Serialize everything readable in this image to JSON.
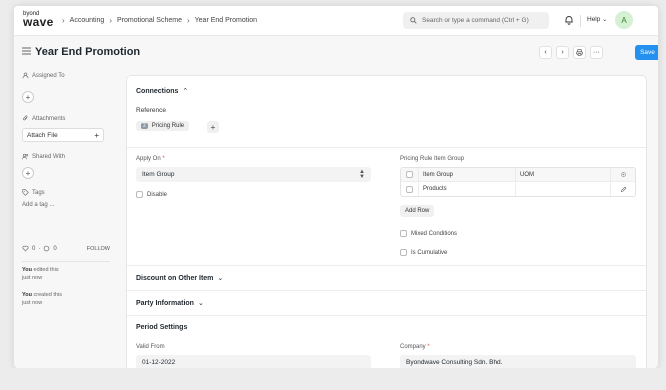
{
  "navbar": {
    "logo_top": "byond",
    "logo_main": "wave",
    "breadcrumbs": [
      "Accounting",
      "Promotional Scheme",
      "Year End Promotion"
    ],
    "search_placeholder": "Search or type a command (Ctrl + G)",
    "help_label": "Help",
    "avatar_initial": "A"
  },
  "page": {
    "title": "Year End Promotion",
    "save_label": "Save"
  },
  "sidebar": {
    "assigned_to": "Assigned To",
    "attachments": "Attachments",
    "attach_file": "Attach File",
    "shared_with": "Shared With",
    "tags": "Tags",
    "add_tag": "Add a tag ...",
    "likes": "0",
    "comments": "0",
    "follow": "FOLLOW",
    "activity": [
      {
        "who": "You",
        "what": "edited this",
        "when": "just now"
      },
      {
        "who": "You",
        "what": "created this",
        "when": "just now"
      }
    ]
  },
  "connections": {
    "title": "Connections",
    "reference_label": "Reference",
    "pricing_rule_count": "2",
    "pricing_rule_label": "Pricing Rule"
  },
  "form": {
    "apply_on_label": "Apply On",
    "apply_on_value": "Item Group",
    "disable_label": "Disable",
    "table_label": "Pricing Rule Item Group",
    "table_headers": [
      "Item Group",
      "UOM"
    ],
    "table_rows": [
      [
        "Products",
        ""
      ]
    ],
    "add_row": "Add Row",
    "mixed_conditions": "Mixed Conditions",
    "is_cumulative": "Is Cumulative"
  },
  "sections": {
    "discount_other_item": "Discount on Other Item",
    "party_information": "Party Information",
    "period_settings": "Period Settings"
  },
  "period": {
    "valid_from_label": "Valid From",
    "valid_from_value": "01-12-2022",
    "company_label": "Company",
    "company_value": "Byondwave Consulting Sdn. Bhd."
  },
  "colors": {
    "primary": "#2490ef",
    "avatar_bg": "#d6f0d4",
    "required": "#e24c4c"
  },
  "icons": [
    "menu-icon",
    "search-icon",
    "bell-icon",
    "chevron-left-icon",
    "chevron-right-icon",
    "printer-icon",
    "more-icon",
    "user-icon",
    "paperclip-icon",
    "share-icon",
    "tag-icon",
    "heart-icon",
    "comment-icon",
    "chevron-up-icon",
    "chevron-down-icon",
    "settings-icon",
    "edit-icon"
  ]
}
